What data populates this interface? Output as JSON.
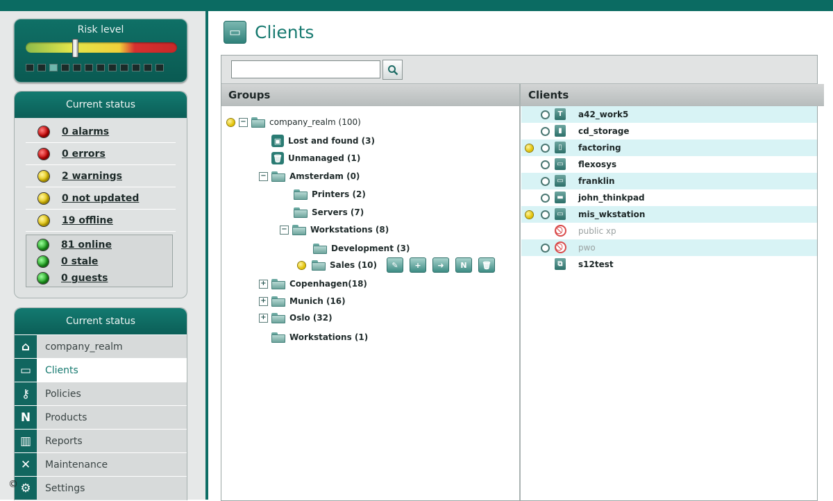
{
  "risk": {
    "title": "Risk level",
    "level_fraction": 0.32
  },
  "current_status": {
    "title": "Current status",
    "items": [
      {
        "label": "0 alarms",
        "color": "red"
      },
      {
        "label": "0 errors",
        "color": "red"
      },
      {
        "label": "2 warnings",
        "color": "yellow"
      },
      {
        "label": "0 not updated",
        "color": "yellow"
      },
      {
        "label": "19 offline",
        "color": "yellow"
      }
    ],
    "box_items": [
      {
        "label": "81 online",
        "color": "green"
      },
      {
        "label": "0 stale",
        "color": "green"
      },
      {
        "label": "0 guests",
        "color": "green"
      }
    ]
  },
  "nav": {
    "title": "Current status",
    "items": [
      {
        "label": "company_realm",
        "icon": "home-icon"
      },
      {
        "label": "Clients",
        "icon": "monitor-icon",
        "active": true
      },
      {
        "label": "Policies",
        "icon": "key-icon"
      },
      {
        "label": "Products",
        "icon": "n-logo-icon"
      },
      {
        "label": "Reports",
        "icon": "chart-icon"
      },
      {
        "label": "Maintenance",
        "icon": "tools-icon"
      },
      {
        "label": "Settings",
        "icon": "gear-icon"
      }
    ]
  },
  "copyright": "©",
  "page": {
    "title": "Clients"
  },
  "search": {
    "value": ""
  },
  "groups": {
    "header": "Groups",
    "nodes": [
      {
        "label": "company_realm (100)"
      },
      {
        "label": "Lost and found (3)"
      },
      {
        "label": "Unmanaged (1)"
      },
      {
        "label": "Amsterdam (0)"
      },
      {
        "label": "Printers (2)"
      },
      {
        "label": "Servers (7)"
      },
      {
        "label": "Workstations (8)"
      },
      {
        "label": "Development (3)"
      },
      {
        "label": "Sales (10)"
      },
      {
        "label": "Copenhagen(18)"
      },
      {
        "label": "Munich (16)"
      },
      {
        "label": "Oslo (32)"
      },
      {
        "label": "Workstations (1)"
      }
    ]
  },
  "clients": {
    "header": "Clients",
    "rows": [
      {
        "name": "a42_work5",
        "warning": false,
        "alt": true,
        "dim": false
      },
      {
        "name": "cd_storage",
        "warning": false,
        "alt": false,
        "dim": false
      },
      {
        "name": "factoring",
        "warning": true,
        "alt": true,
        "dim": false
      },
      {
        "name": "flexosys",
        "warning": false,
        "alt": false,
        "dim": false
      },
      {
        "name": "franklin",
        "warning": false,
        "alt": true,
        "dim": false
      },
      {
        "name": "john_thinkpad",
        "warning": false,
        "alt": false,
        "dim": false
      },
      {
        "name": "mis_wkstation",
        "warning": true,
        "alt": true,
        "dim": false
      },
      {
        "name": "public xp",
        "warning": false,
        "alt": false,
        "dim": true
      },
      {
        "name": "pwo",
        "warning": false,
        "alt": true,
        "dim": true
      },
      {
        "name": "s12test",
        "warning": false,
        "alt": false,
        "dim": false
      }
    ]
  }
}
